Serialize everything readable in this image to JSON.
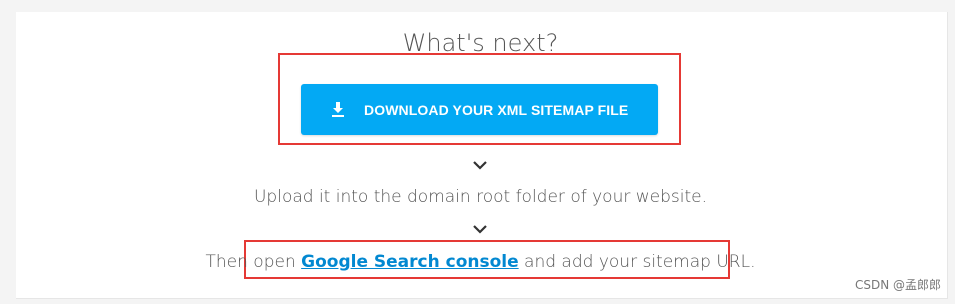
{
  "section": {
    "title": "What's next?"
  },
  "download": {
    "label": "DOWNLOAD YOUR XML SITEMAP FILE",
    "icon": "download-icon",
    "color": "#03a9f4"
  },
  "steps": {
    "upload_text": "Upload it into the domain root folder of your website.",
    "open_prefix": "Then open ",
    "open_link": "Google Search console",
    "open_suffix": " and add your sitemap URL."
  },
  "highlight_color": "#e53935",
  "watermark": "CSDN @孟郎郎"
}
